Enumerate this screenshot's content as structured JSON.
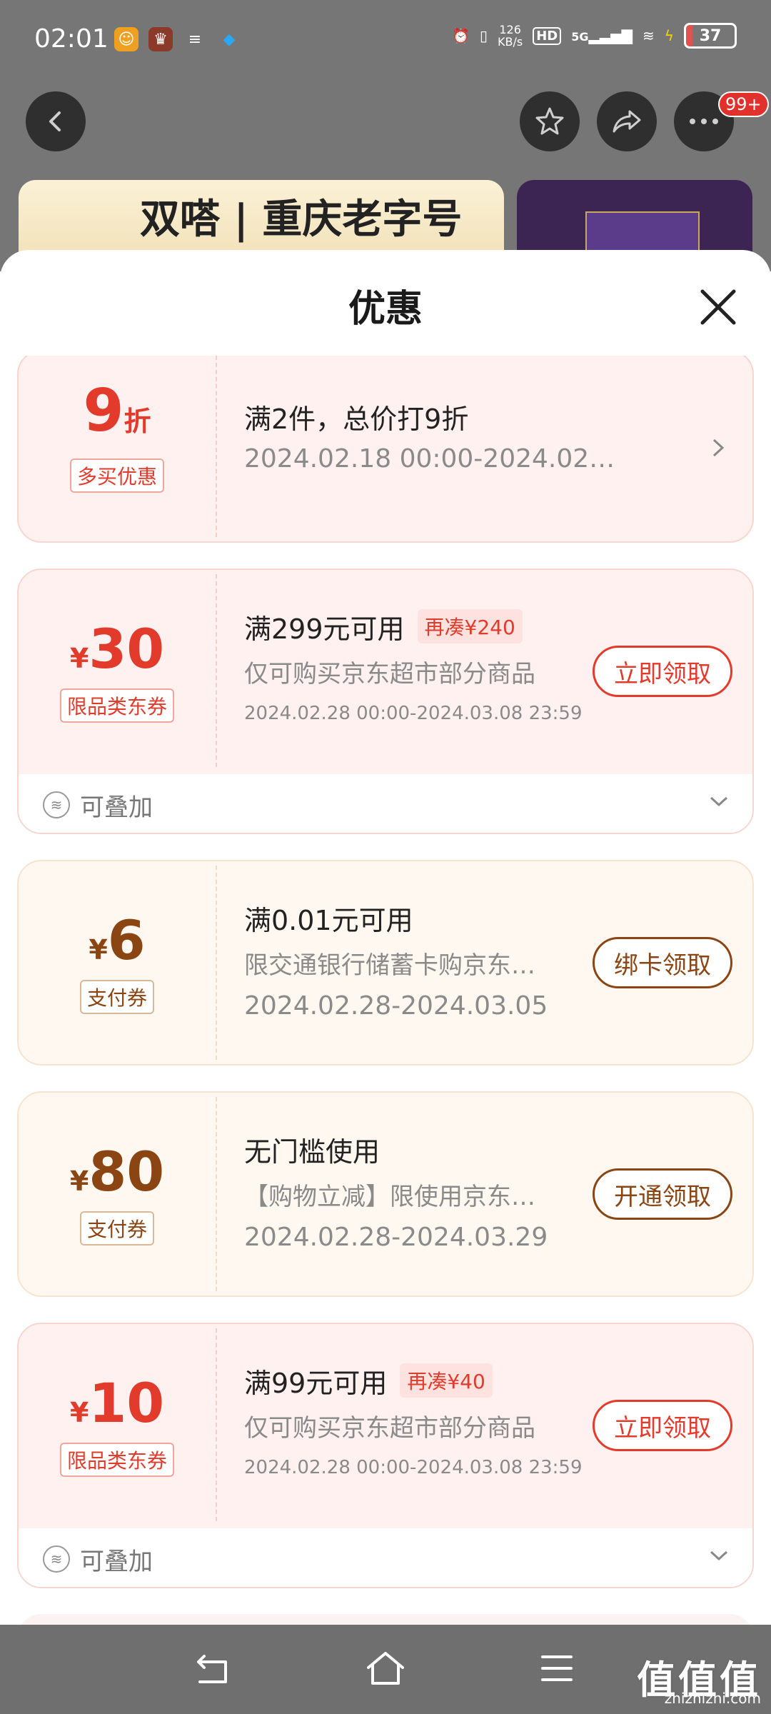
{
  "status_bar": {
    "time": "02:01",
    "net_speed_value": "126",
    "net_speed_unit": "KB/s",
    "hd": "HD",
    "signal": "5G",
    "battery": "37"
  },
  "top_nav": {
    "badge": "99+"
  },
  "banner": {
    "brand_text": "双嗒 | 重庆老字号"
  },
  "sheet": {
    "title": "优惠"
  },
  "coupons": [
    {
      "amount": "9",
      "unit": "折",
      "tag": "多买优惠",
      "line1": "满2件，总价打9折",
      "line2": "2024.02.18 00:00-2024.02.2…"
    },
    {
      "currency": "¥",
      "amount": "30",
      "tag": "限品类东券",
      "line1": "满299元可用",
      "extra": "再凑¥240",
      "line2": "仅可购买京东超市部分商品",
      "line3": "2024.02.28 00:00-2024.03.08 23:59",
      "button": "立即领取",
      "stack": "可叠加"
    },
    {
      "currency": "¥",
      "amount": "6",
      "tag": "支付券",
      "line1": "满0.01元可用",
      "line2": "限交通银行储蓄卡购京东…",
      "line3": "2024.02.28-2024.03.05",
      "button": "绑卡领取"
    },
    {
      "currency": "¥",
      "amount": "80",
      "tag": "支付券",
      "line1": "无门槛使用",
      "line2": "【购物立减】限使用京东…",
      "line3": "2024.02.28-2024.03.29",
      "button": "开通领取"
    },
    {
      "currency": "¥",
      "amount": "10",
      "tag": "限品类东券",
      "line1": "满99元可用",
      "extra": "再凑¥40",
      "line2": "仅可购买京东超市部分商品",
      "line3": "2024.02.28 00:00-2024.03.08 23:59",
      "button": "立即领取",
      "stack": "可叠加"
    }
  ],
  "stack_icon_glyph": "≋",
  "watermark": {
    "text": "值值值",
    "domain": "zhizhizhi.com"
  },
  "colors": {
    "red": "#e23b2c",
    "brown": "#8b4513",
    "pink_bg": "#fff1ef",
    "cream_bg": "#fff8f0"
  }
}
